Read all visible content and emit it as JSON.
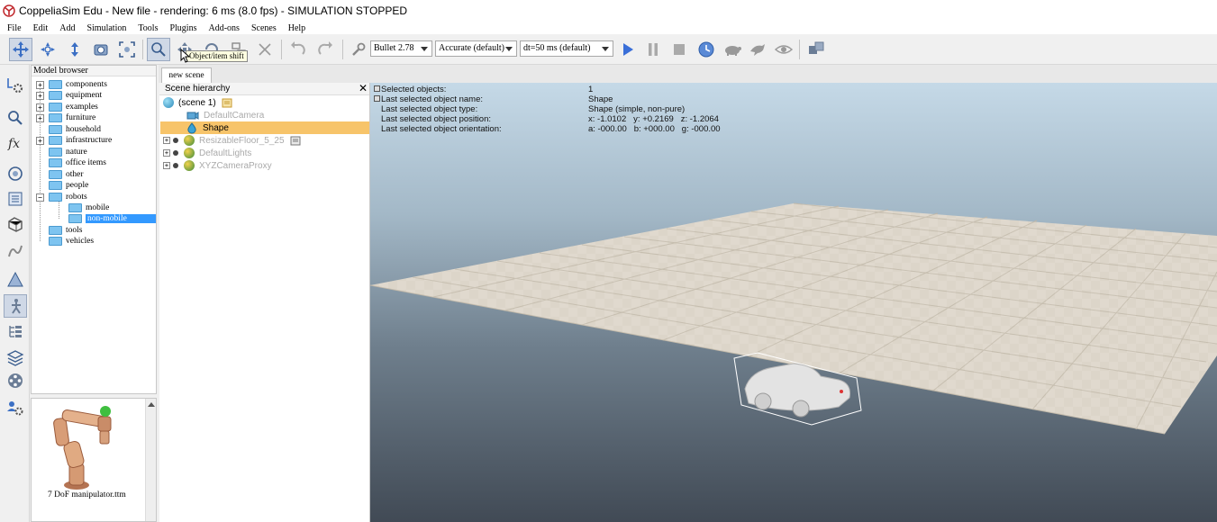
{
  "window": {
    "title": "CoppeliaSim Edu - New file - rendering: 6 ms (8.0 fps) - SIMULATION STOPPED"
  },
  "menu": [
    "File",
    "Edit",
    "Add",
    "Simulation",
    "Tools",
    "Plugins",
    "Add-ons",
    "Scenes",
    "Help"
  ],
  "toolbar": {
    "tooltip": "Object/item shift",
    "physics_engine": "Bullet 2.78",
    "accuracy": "Accurate (default)",
    "timestep": "dt=50 ms (default)",
    "icons": [
      "move-camera-icon",
      "rotate-camera-icon",
      "shift-camera-icon",
      "camera-angle-icon",
      "fit-to-view-icon",
      "click-select-icon",
      "object-shift-icon",
      "object-rotate-icon",
      "assemble-icon",
      "transfer-dna-icon",
      "undo-icon",
      "redo-icon",
      "dynamics-wrench-icon",
      "play-icon",
      "pause-icon",
      "stop-icon",
      "real-time-icon",
      "slow-down-icon",
      "speed-up-icon",
      "visualization-eye-icon",
      "page-selector-icon"
    ]
  },
  "left_toolbar": {
    "icons": [
      "simulation-settings-icon",
      "selection-search-icon",
      "function-script-icon",
      "layers-icon",
      "scene-object-properties-icon",
      "shape-edit-icon",
      "path-icon",
      "calculation-modules-icon",
      "ik-icon",
      "collections-icon",
      "scripts-icon",
      "video-recorder-icon",
      "user-settings-icon"
    ]
  },
  "model_browser": {
    "title": "Model browser",
    "items": [
      {
        "label": "components",
        "expandable": true,
        "depth": 0
      },
      {
        "label": "equipment",
        "expandable": true,
        "depth": 0
      },
      {
        "label": "examples",
        "expandable": true,
        "depth": 0
      },
      {
        "label": "furniture",
        "expandable": true,
        "depth": 0
      },
      {
        "label": "household",
        "expandable": false,
        "depth": 0
      },
      {
        "label": "infrastructure",
        "expandable": true,
        "depth": 0
      },
      {
        "label": "nature",
        "expandable": false,
        "depth": 0
      },
      {
        "label": "office items",
        "expandable": false,
        "depth": 0
      },
      {
        "label": "other",
        "expandable": false,
        "depth": 0
      },
      {
        "label": "people",
        "expandable": false,
        "depth": 0
      },
      {
        "label": "robots",
        "expandable": true,
        "expanded": true,
        "depth": 0
      },
      {
        "label": "mobile",
        "expandable": false,
        "depth": 1
      },
      {
        "label": "non-mobile",
        "expandable": false,
        "depth": 1,
        "selected": true
      },
      {
        "label": "tools",
        "expandable": false,
        "depth": 0
      },
      {
        "label": "vehicles",
        "expandable": false,
        "depth": 0
      }
    ],
    "preview_label": "7 DoF manipulator.ttm"
  },
  "scene_tab": {
    "label": "new scene"
  },
  "scene_hierarchy": {
    "title": "Scene hierarchy",
    "close": "✕",
    "rows": [
      {
        "label": "(scene 1)",
        "greyed": false,
        "selected": false
      },
      {
        "label": "DefaultCamera",
        "greyed": true,
        "selected": false
      },
      {
        "label": "Shape",
        "greyed": false,
        "selected": true
      },
      {
        "label": "ResizableFloor_5_25",
        "greyed": true,
        "selected": false
      },
      {
        "label": "DefaultLights",
        "greyed": true,
        "selected": false
      },
      {
        "label": "XYZCameraProxy",
        "greyed": true,
        "selected": false
      }
    ]
  },
  "viewport_info": {
    "rows": [
      {
        "key": "Selected objects:",
        "value": "1"
      },
      {
        "key": "Last selected object name:",
        "value": "Shape"
      },
      {
        "key": "Last selected object type:",
        "value": "Shape (simple, non-pure)"
      },
      {
        "key": "Last selected object position:",
        "value": "x: -1.0102   y: +0.2169   z: -1.2064"
      },
      {
        "key": "Last selected object orientation:",
        "value": "a: -000.00   b: +000.00   g: -000.00"
      }
    ]
  },
  "colors": {
    "accent_selection": "#3399ff",
    "scene_selection": "#f7c46a",
    "folder": "#7ec4f0",
    "play_button": "#3a6fd8"
  }
}
